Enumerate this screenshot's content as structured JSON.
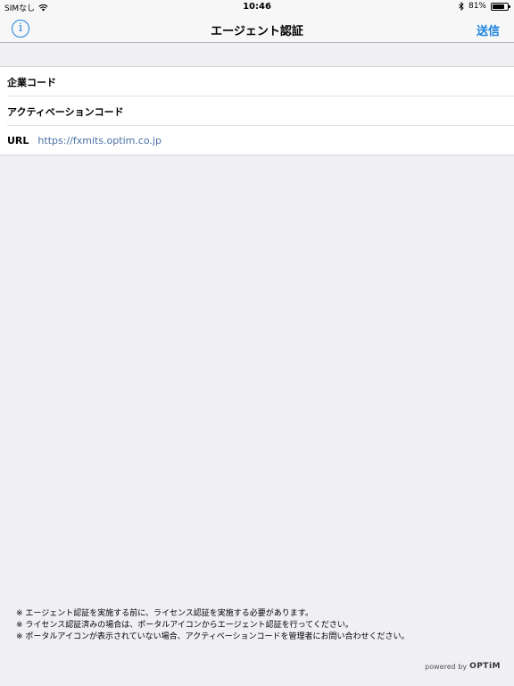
{
  "status_bar": {
    "carrier": "SIMなし",
    "time": "10:46",
    "battery": "81%",
    "battery_level": 0.81
  },
  "nav": {
    "info_icon": "i",
    "title": "エージェント認証",
    "send_label": "送信"
  },
  "form": {
    "company_code_label": "企業コード",
    "activation_code_label": "アクティベーションコード",
    "url_label": "URL",
    "url_value": "https://fxmits.optim.co.jp"
  },
  "notes": [
    "※ エージェント認証を実施する前に、ライセンス認証を実施する必要があります。",
    "※ ライセンス認証済みの場合は、ポータルアイコンからエージェント認証を行ってください。",
    "※ ポータルアイコンが表示されていない場合、アクティベーションコードを管理者にお問い合わせください。"
  ],
  "footer": {
    "powered_by": "powered by",
    "brand": "OPTiM"
  },
  "colors": {
    "accent": "#1a82e0",
    "background": "#efeff4"
  }
}
